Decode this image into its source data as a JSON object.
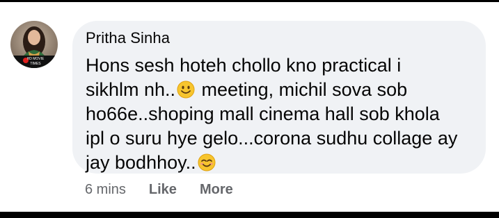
{
  "comment": {
    "author": "Pritha Sinha",
    "lines": [
      "Hons sesh hoteh chollo kno practical i",
      "sikhlm nh..",
      " meeting, michil sova sob",
      "ho66e..shoping mall cinema hall sob khola",
      "ipl o suru hye gelo...corona sudhu collage ay",
      "jay bodhhoy.."
    ],
    "emojis": [
      "slightly-smiling-face-icon",
      "smiling-face-with-smiling-eyes-icon"
    ],
    "avatar_badge_text": "HD MOVIE TIMES",
    "timestamp": "6 mins",
    "like_label": "Like",
    "more_label": "More"
  },
  "colors": {
    "bubble": "#f0f2f5",
    "text": "#050505",
    "meta": "#65676b"
  }
}
